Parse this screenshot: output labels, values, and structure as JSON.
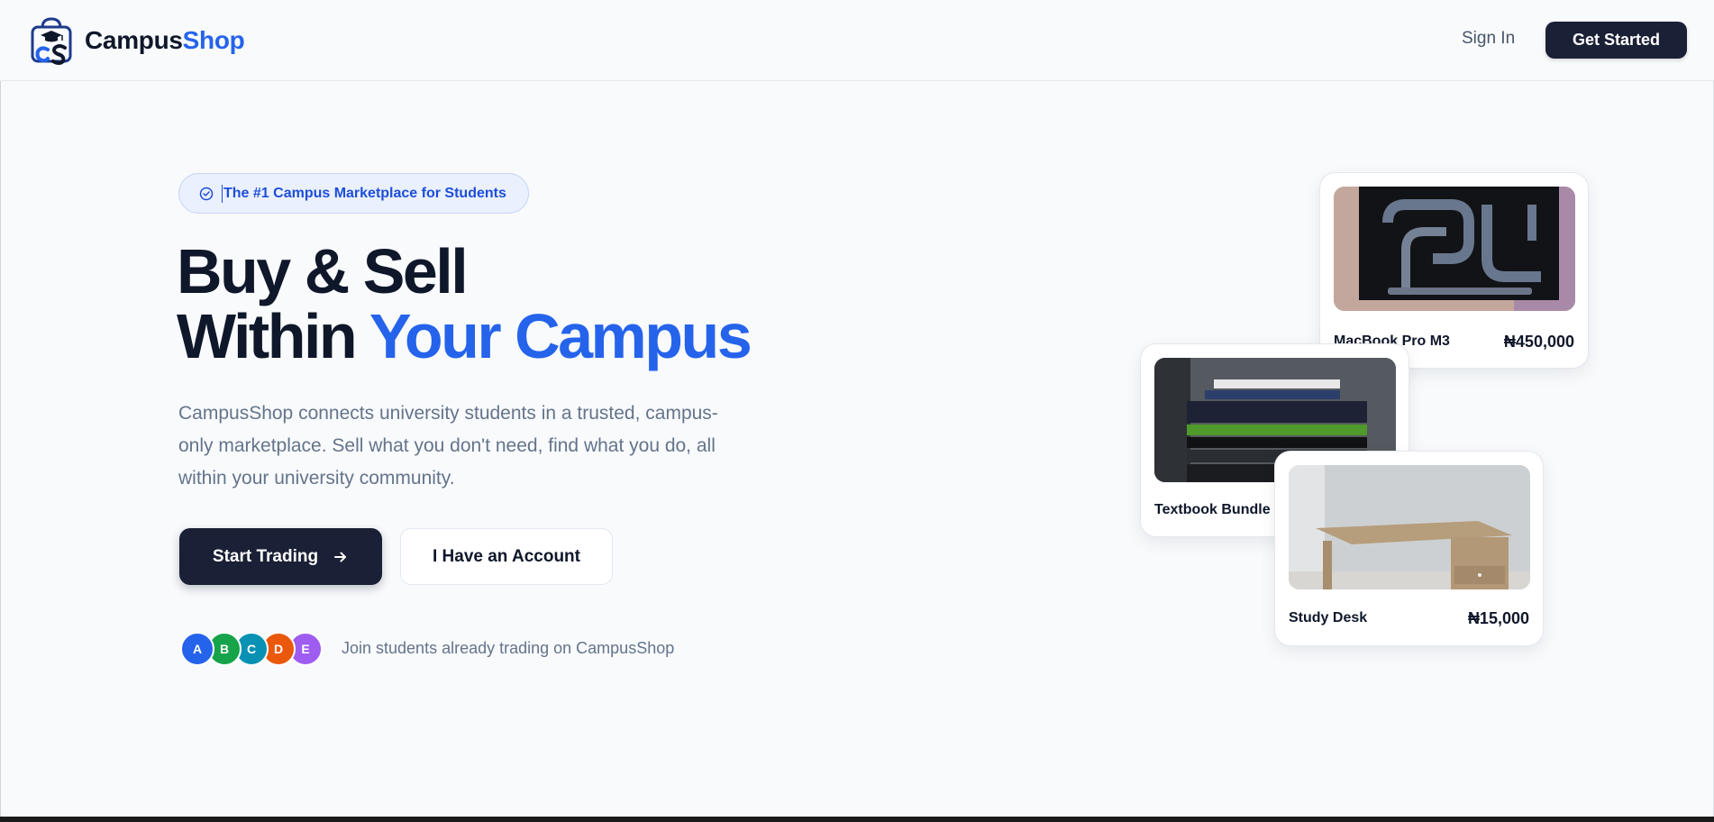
{
  "header": {
    "brand_primary": "Campus",
    "brand_accent": "Shop",
    "signin_label": "Sign In",
    "get_started_label": "Get Started"
  },
  "hero": {
    "badge_text": "The #1 Campus Marketplace for Students",
    "headline_line1": "Buy & Sell",
    "headline_line2_plain": "Within ",
    "headline_line2_accent": "Your Campus",
    "description": "CampusShop connects university students in a trusted, campus-only marketplace. Sell what you don't need, find what you do, all within your university community.",
    "primary_button": "Start Trading",
    "secondary_button": "I Have an Account",
    "avatars": [
      {
        "initial": "A",
        "color": "#2563eb"
      },
      {
        "initial": "B",
        "color": "#16a34a"
      },
      {
        "initial": "C",
        "color": "#0891b2"
      },
      {
        "initial": "D",
        "color": "#ea580c"
      },
      {
        "initial": "E",
        "color": "#9f5cf0"
      }
    ],
    "social_text": "Join students already trading on CampusShop"
  },
  "products": [
    {
      "name": "MacBook Pro M3",
      "price": "₦450,000"
    },
    {
      "name": "Textbook Bundle",
      "price": ""
    },
    {
      "name": "Study Desk",
      "price": "₦15,000"
    }
  ],
  "colors": {
    "accent": "#2563eb",
    "dark": "#1a2035",
    "muted": "#64748b"
  },
  "icons": {
    "logo": "campus-shop-bag-logo",
    "badge": "check-circle-icon",
    "arrow": "arrow-right-icon"
  }
}
